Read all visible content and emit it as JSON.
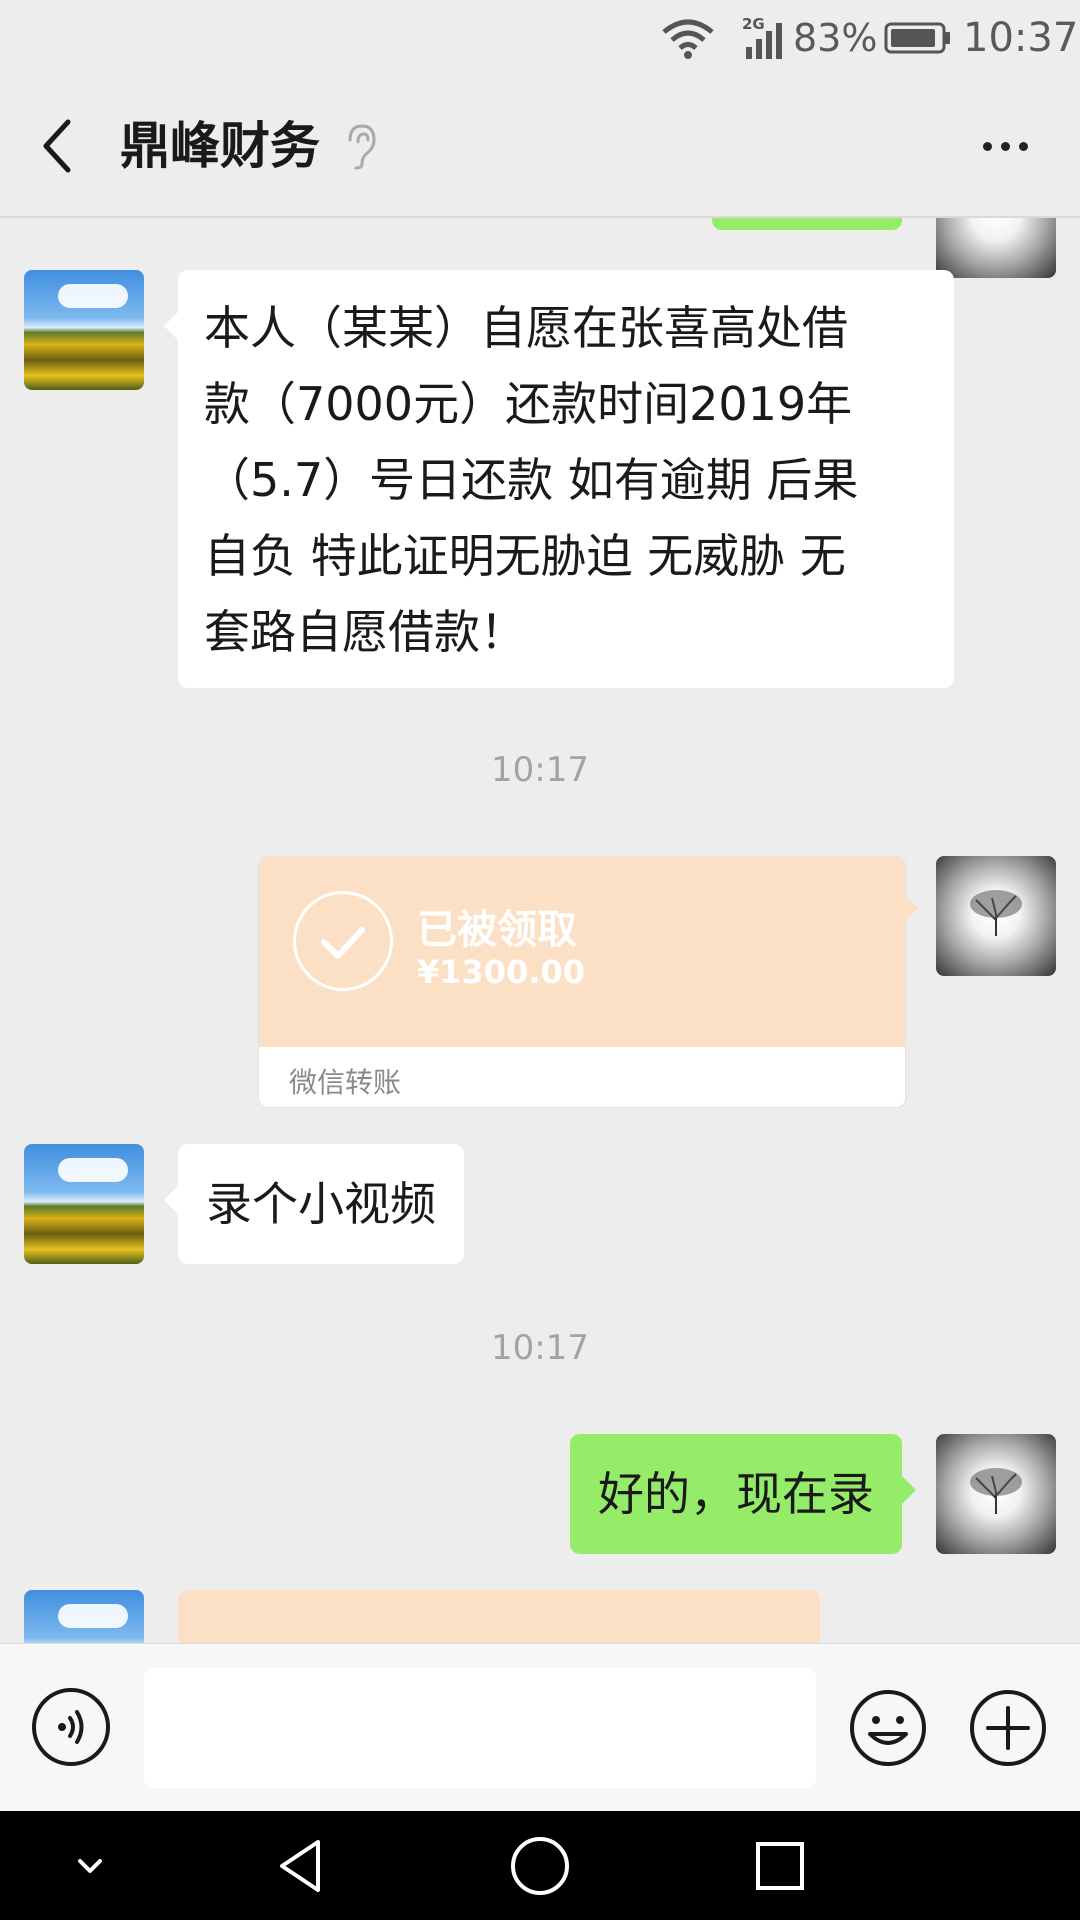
{
  "status_bar": {
    "network": "2G",
    "battery_percent": "83%",
    "time": "10:37"
  },
  "header": {
    "title": "鼎峰财务"
  },
  "messages": [
    {
      "sender": "contact",
      "type": "text",
      "text": "本人（某某）自愿在张喜高处借款（7000元）还款时间2019年（5.7）号日还款 如有逾期 后果自负 特此证明无胁迫 无威胁 无套路自愿借款！",
      "lines": [
        "本人（某某）自愿在张喜高处借",
        "款（7000元）还款时间2019年",
        "（5.7）号日还款  如有逾期 后果",
        "自负  特此证明无胁迫  无威胁 无",
        "套路自愿借款！"
      ]
    },
    {
      "type": "timestamp",
      "text": "10:17"
    },
    {
      "sender": "me",
      "type": "transfer",
      "status": "已被领取",
      "amount": "¥1300.00",
      "label": "微信转账"
    },
    {
      "sender": "contact",
      "type": "text",
      "text": "录个小视频"
    },
    {
      "type": "timestamp",
      "text": "10:17"
    },
    {
      "sender": "me",
      "type": "text",
      "text": "好的，现在录"
    }
  ],
  "input_bar": {
    "placeholder": "",
    "icons": [
      "voice-icon",
      "emoji-icon",
      "plus-icon"
    ]
  },
  "nav_bar": {
    "icons": [
      "collapse-icon",
      "back-triangle-icon",
      "home-circle-icon",
      "recents-square-icon"
    ]
  },
  "colors": {
    "background": "#ededed",
    "my_bubble": "#95ec69",
    "transfer": "#fbe0c5"
  }
}
